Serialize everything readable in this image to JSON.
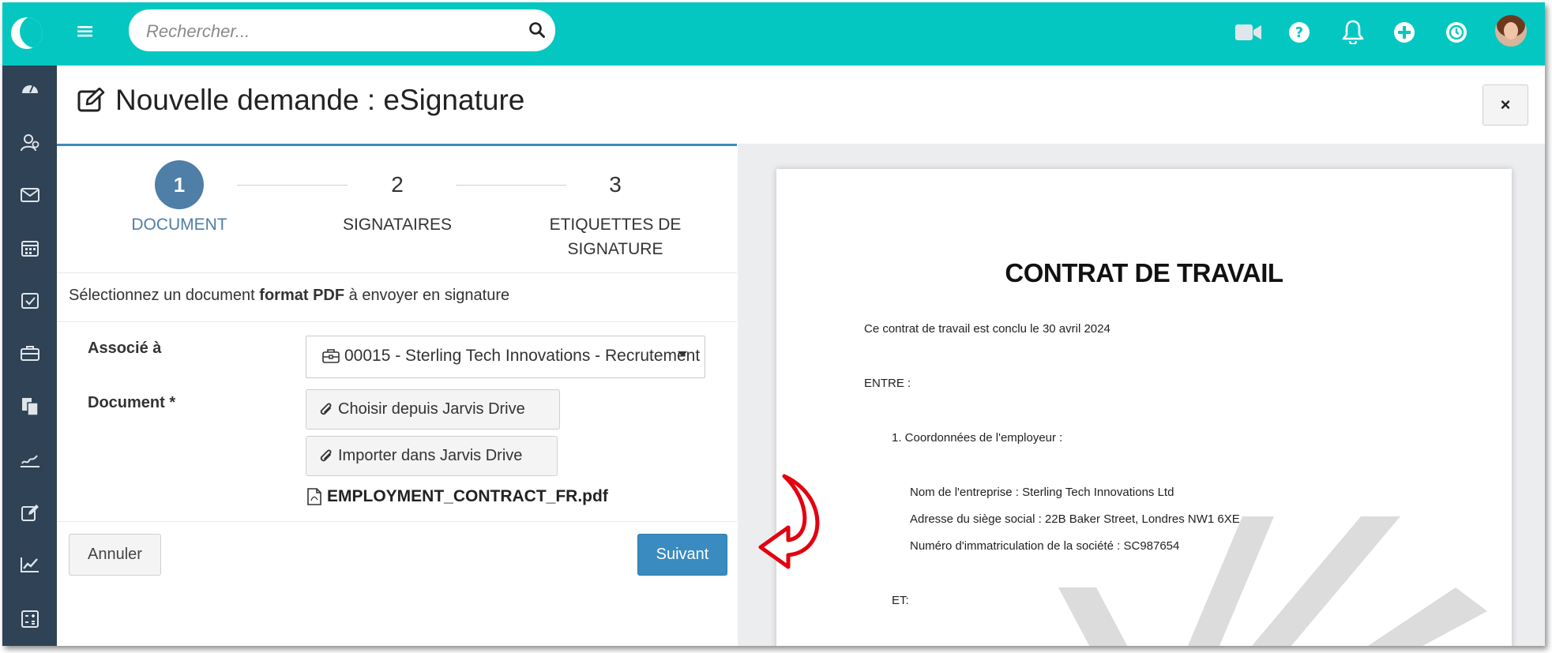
{
  "topbar": {
    "search_placeholder": "Rechercher...",
    "icons": [
      "video-icon",
      "help-icon",
      "bell-icon",
      "add-icon",
      "clock-icon"
    ]
  },
  "sidebar": {
    "icons": [
      "dashboard-icon",
      "contacts-icon",
      "mail-icon",
      "calendar-icon",
      "tasks-icon",
      "briefcase-icon",
      "documents-icon",
      "signature-icon",
      "edit-icon",
      "chart-icon",
      "calculator-icon"
    ]
  },
  "header": {
    "title": "Nouvelle demande : eSignature",
    "close_label": "×"
  },
  "wizard": {
    "steps": [
      {
        "number": "1",
        "label": "DOCUMENT",
        "active": true
      },
      {
        "number": "2",
        "label": "SIGNATAIRES",
        "active": false
      },
      {
        "number": "3",
        "label": "ETIQUETTES DE SIGNATURE",
        "active": false
      }
    ],
    "instruction_before": "Sélectionnez un document ",
    "instruction_bold": "format PDF",
    "instruction_after": " à envoyer en signature"
  },
  "form": {
    "associe_label": "Associé à",
    "associe_value": "00015 - Sterling Tech Innovations - Recrutement",
    "document_label": "Document *",
    "choose_drive_label": "Choisir depuis Jarvis Drive",
    "import_drive_label": "Importer dans Jarvis Drive",
    "file_name": "EMPLOYMENT_CONTRACT_FR.pdf",
    "cancel_label": "Annuler",
    "next_label": "Suivant"
  },
  "preview": {
    "title": "CONTRAT DE TRAVAIL",
    "intro": "Ce contrat de travail est conclu le 30 avril 2024",
    "entre": "ENTRE :",
    "section1": "1.   Coordonnées de l'employeur :",
    "company_name": "Nom de l'entreprise : Sterling Tech Innovations Ltd",
    "address": "Adresse du siège social : 22B Baker Street, Londres NW1 6XE",
    "registration": "Numéro d'immatriculation de la société : SC987654",
    "et": "ET:"
  },
  "colors": {
    "topbar": "#05c7c2",
    "sidebar": "#2f4256",
    "accent": "#3a8bbf",
    "step_active": "#4f7ea6",
    "arrow": "#e3000f"
  }
}
